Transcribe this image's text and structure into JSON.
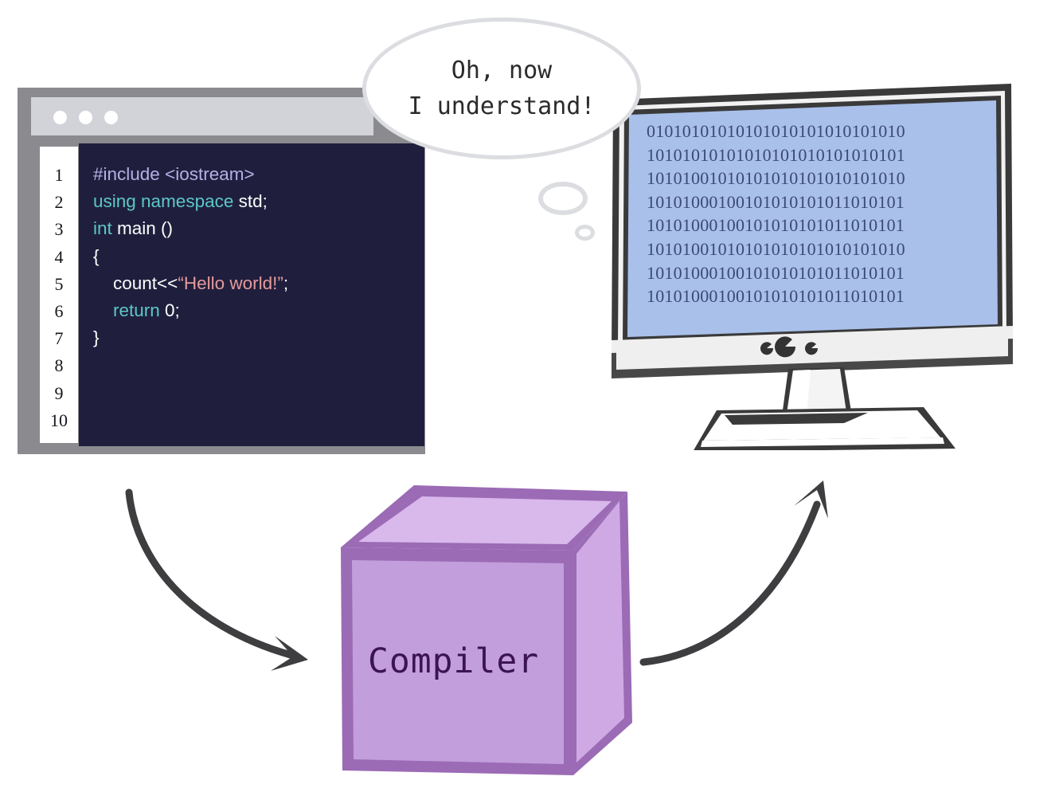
{
  "editor": {
    "title_dots": [
      "close-dot",
      "minimize-dot",
      "maximize-dot"
    ],
    "line_numbers": [
      "1",
      "2",
      "3",
      "4",
      "5",
      "6",
      "7",
      "8",
      "9",
      "10"
    ],
    "code_lines": [
      {
        "n": 1,
        "tokens": [
          {
            "t": "#include <iostream>",
            "c": "pre"
          }
        ]
      },
      {
        "n": 2,
        "tokens": [
          {
            "t": "using namespace ",
            "c": "kw"
          },
          {
            "t": "std;",
            "c": "plain"
          }
        ]
      },
      {
        "n": 3,
        "tokens": [
          {
            "t": "int ",
            "c": "kw"
          },
          {
            "t": "main ()",
            "c": "plain"
          }
        ]
      },
      {
        "n": 4,
        "tokens": [
          {
            "t": "{",
            "c": "plain"
          }
        ]
      },
      {
        "n": 5,
        "tokens": [
          {
            "t": "    count<<",
            "c": "plain"
          },
          {
            "t": "“Hello world!”",
            "c": "str"
          },
          {
            "t": ";",
            "c": "plain"
          }
        ]
      },
      {
        "n": 6,
        "tokens": [
          {
            "t": "    ",
            "c": "plain"
          },
          {
            "t": "return ",
            "c": "kw"
          },
          {
            "t": "0;",
            "c": "plain"
          }
        ]
      },
      {
        "n": 7,
        "tokens": [
          {
            "t": "}",
            "c": "plain"
          }
        ]
      }
    ],
    "code_plain_text": [
      "#include <iostream>",
      "using namespace std;",
      "int main ()",
      "{",
      "    count<<“Hello world!”;",
      "    return 0;",
      "}"
    ],
    "colors": {
      "background": "#1f1f3d",
      "preprocessor": "#b6afe6",
      "keyword": "#5cc8c8",
      "plain": "#ffffff",
      "string": "#e59a9b",
      "frame": "#8b8b8f",
      "titlebar": "#d2d3d9",
      "gutter": "#ffffff"
    }
  },
  "thought": {
    "line1": "Oh, now",
    "line2": "I understand!",
    "bubble_fill": "#ffffff",
    "bubble_stroke": "#dcdde1"
  },
  "monitor": {
    "screen_color": "#a9c0ea",
    "frame_color": "#3a3a3a",
    "bezel_color": "#efefef",
    "binary_text_color": "#3b4a73",
    "binary_rows": [
      "01010101010101010101010101010",
      "10101010101010101010101010101",
      "10101001010101010101010101010",
      "10101000100101010101011010101",
      "10101000100101010101011010101",
      "10101001010101010101010101010",
      "10101000100101010101011010101",
      "10101000100101010101011010101"
    ],
    "bezel_controls": [
      "power-dot-left",
      "power-dot-center",
      "power-dot-right"
    ]
  },
  "cube": {
    "label": "Compiler",
    "front_color": "#c29edc",
    "top_color": "#d9b8ec",
    "side_color": "#cfa9e4",
    "edge_color": "#9b6bb5",
    "label_color": "#3d1452"
  },
  "arrows": {
    "color": "#3e3e40",
    "left": {
      "name": "code-to-compiler-arrow",
      "direction": "down-right"
    },
    "right": {
      "name": "compiler-to-monitor-arrow",
      "direction": "up-right"
    }
  }
}
